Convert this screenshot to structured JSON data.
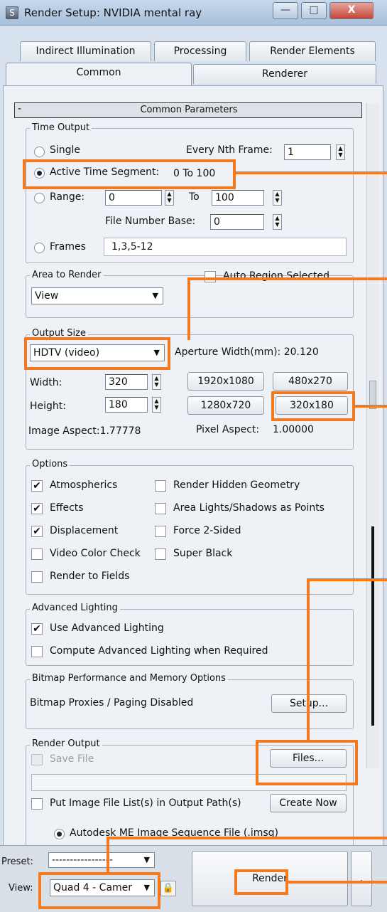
{
  "window": {
    "title": "Render Setup: NVIDIA mental ray",
    "app_icon": "3ds-max-icon",
    "minimize": "—",
    "maximize": "□",
    "close": "X"
  },
  "tabs": {
    "row1": [
      "Indirect Illumination",
      "Processing",
      "Render Elements"
    ],
    "row2": [
      "Common",
      "Renderer"
    ],
    "active": "Common"
  },
  "rollout": {
    "toggle": "-",
    "title": "Common Parameters"
  },
  "time_output": {
    "title": "Time Output",
    "single": "Single",
    "every_nth_label": "Every Nth Frame:",
    "every_nth_value": "1",
    "active_segment": "Active Time Segment:",
    "active_segment_value": "0 To 100",
    "range": "Range:",
    "range_from": "0",
    "range_to_label": "To",
    "range_to": "100",
    "file_number_base_label": "File Number Base:",
    "file_number_base": "0",
    "frames": "Frames",
    "frames_value": "1,3,5-12",
    "selected": "Active Time Segment"
  },
  "area_to_render": {
    "title": "Area to Render",
    "value": "View",
    "auto_region": "Auto Region Selected",
    "auto_region_checked": false
  },
  "output_size": {
    "title": "Output Size",
    "preset": "HDTV (video)",
    "aperture": "Aperture Width(mm): 20.120",
    "width_label": "Width:",
    "width": "320",
    "height_label": "Height:",
    "height": "180",
    "presets": [
      "1920x1080",
      "480x270",
      "1280x720",
      "320x180"
    ],
    "image_aspect": "Image Aspect:1.77778",
    "pixel_aspect_label": "Pixel Aspect:",
    "pixel_aspect": "1.00000"
  },
  "options": {
    "title": "Options",
    "left": [
      {
        "label": "Atmospherics",
        "checked": "✔"
      },
      {
        "label": "Effects",
        "checked": "✔"
      },
      {
        "label": "Displacement",
        "checked": "✔"
      },
      {
        "label": "Video Color Check",
        "checked": ""
      },
      {
        "label": "Render to Fields",
        "checked": ""
      }
    ],
    "right": [
      {
        "label": "Render Hidden Geometry",
        "checked": ""
      },
      {
        "label": "Area Lights/Shadows as Points",
        "checked": ""
      },
      {
        "label": "Force 2-Sided",
        "checked": ""
      },
      {
        "label": "Super Black",
        "checked": ""
      }
    ]
  },
  "advanced_lighting": {
    "title": "Advanced Lighting",
    "use": "Use Advanced Lighting",
    "use_checked": "✔",
    "compute": "Compute Advanced Lighting when Required",
    "compute_checked": ""
  },
  "bitmap": {
    "title": "Bitmap Performance and Memory Options",
    "status": "Bitmap Proxies / Paging Disabled",
    "setup": "Setup..."
  },
  "render_output": {
    "title": "Render Output",
    "save_file": "Save File",
    "files": "Files...",
    "path": "",
    "put_list": "Put Image File List(s) in Output Path(s)",
    "create_now": "Create Now",
    "autodesk": "Autodesk ME Image Sequence File (.imsq)"
  },
  "footer": {
    "preset_label": "Preset:",
    "preset_value": "-----------------",
    "view_label": "View:",
    "view_value": "Quad 4 - Camer",
    "lock_icon": "lock-icon",
    "render": "Render",
    "extra": "."
  },
  "highlight_color": "#f47a20"
}
